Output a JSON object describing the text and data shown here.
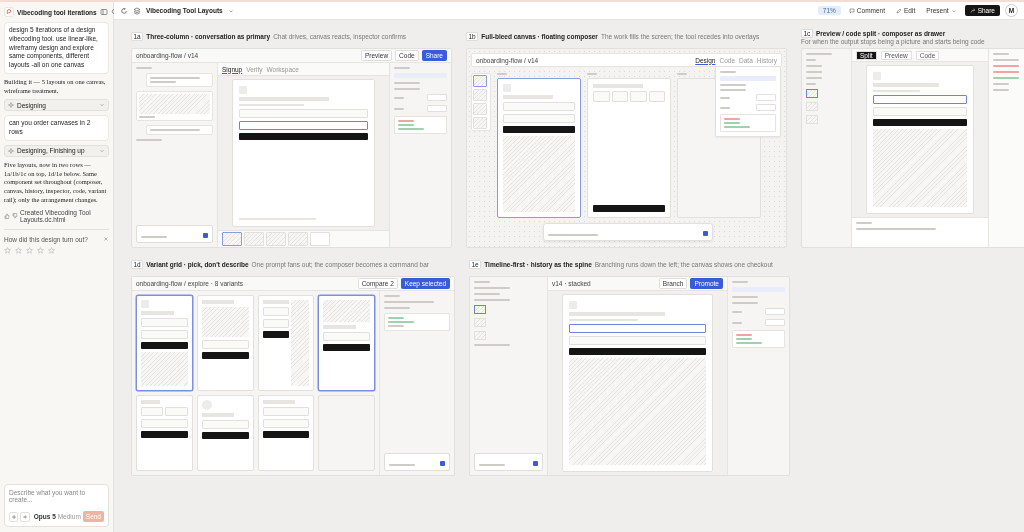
{
  "sidebar": {
    "project_title": "Vibecoding tool iterations",
    "messages": [
      {
        "kind": "user",
        "text": "design 5 iterations of a design vibecoding tool. use linear-like, wireframy design and explore same components, different layouts -all on one canvas"
      },
      {
        "kind": "assistant",
        "text": "Building it — 5 layouts on one canvas, wireframe treatment."
      },
      {
        "kind": "status",
        "text": "Designing"
      },
      {
        "kind": "user",
        "text": "can you order canvases in 2 rows"
      },
      {
        "kind": "status",
        "text": "Designing, Finishing up"
      },
      {
        "kind": "assistant",
        "text": "Five layouts, now in two rows — 1a/1b/1c on top, 1d/1e below. Same component set throughout (composer, canvas, history, inspector, code, variant rail); only the arrangement changes."
      },
      {
        "kind": "file",
        "text": "Created Vibecoding Tool Layouts.dc.html"
      }
    ],
    "feedback": {
      "question": "How did this design turn out?",
      "stars": 0
    },
    "composer": {
      "placeholder": "Describe what you want to create...",
      "model": "Opus 5",
      "effort": "Medium",
      "send": "Send"
    }
  },
  "toolbar": {
    "title": "Vibecoding Tool Layouts",
    "zoom": "71%",
    "buttons": [
      {
        "kind": "comment",
        "label": "Comment"
      },
      {
        "kind": "edit",
        "label": "Edit"
      },
      {
        "kind": "present",
        "label": "Present"
      },
      {
        "kind": "share",
        "label": "Share"
      }
    ],
    "avatar": "M"
  },
  "artboards": [
    {
      "kind": "three-column",
      "badge": "1a",
      "title": "Three-column · conversation as primary",
      "subtitle": "Chat drives, canvas reacts, inspector confirms",
      "breadcrumb": "onboarding-flow / v14",
      "actions": [
        {
          "label": "Preview",
          "primary": false
        },
        {
          "label": "Code",
          "primary": false
        },
        {
          "label": "Share",
          "primary": true
        }
      ],
      "tabs": [
        {
          "label": "Signup",
          "selected": true
        },
        {
          "label": "Verify",
          "selected": false
        },
        {
          "label": "Workspace",
          "selected": false
        }
      ]
    },
    {
      "kind": "full-bleed",
      "badge": "1b",
      "title": "Full-bleed canvas · floating composer",
      "subtitle": "The work fills the screen; the tool recedes into overlays",
      "breadcrumb": "onboarding-flow / v14",
      "tabs": [
        {
          "label": "Design",
          "selected": true
        },
        {
          "label": "Code",
          "selected": false
        },
        {
          "label": "Data",
          "selected": false
        },
        {
          "label": "History",
          "selected": false
        }
      ]
    },
    {
      "kind": "preview-code",
      "badge": "1c",
      "title": "Preview / code split · composer as drawer",
      "subtitle": "For when the output stops being a picture and starts being code",
      "tabs": [
        {
          "label": "Split",
          "selected": true
        },
        {
          "label": "Preview",
          "selected": false
        },
        {
          "label": "Code",
          "selected": false
        }
      ]
    },
    {
      "kind": "variant-grid",
      "badge": "1d",
      "title": "Variant grid · pick, don't describe",
      "subtitle": "One prompt fans out; the composer becomes a command bar",
      "breadcrumb": "onboarding-flow / explore · 8 variants",
      "actions": [
        {
          "label": "Compare 2",
          "primary": false
        },
        {
          "label": "Keep selected",
          "primary": true
        }
      ],
      "variants": [
        {
          "kind": "stacked",
          "selected": true
        },
        {
          "kind": "image-top",
          "selected": false
        },
        {
          "kind": "side-image",
          "selected": false
        },
        {
          "kind": "banner",
          "selected": true
        },
        {
          "kind": "two-col",
          "selected": false
        },
        {
          "kind": "avatar",
          "selected": false
        },
        {
          "kind": "list",
          "selected": false
        },
        {
          "kind": "pending",
          "selected": false
        }
      ]
    },
    {
      "kind": "timeline",
      "badge": "1e",
      "title": "Timeline-first · history as the spine",
      "subtitle": "Branching runs down the left; the canvas shows one checkout",
      "version": "v14 · stacked",
      "actions": [
        {
          "label": "Branch",
          "primary": false
        },
        {
          "label": "Promote",
          "primary": true
        }
      ]
    }
  ]
}
